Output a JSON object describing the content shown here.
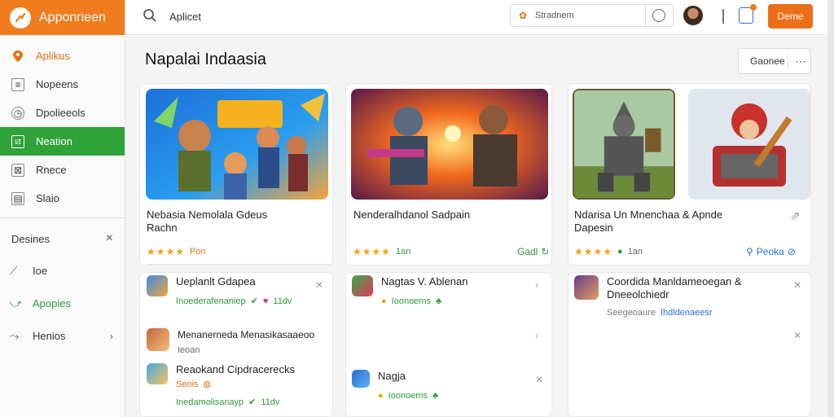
{
  "sidebar": {
    "brand": "Apponrieen",
    "items": [
      {
        "label": "Aplikus",
        "icon": "pin-icon"
      },
      {
        "label": "Nopeens",
        "icon": "list-icon"
      },
      {
        "label": "Dpolieeols",
        "icon": "clock-icon"
      },
      {
        "label": "Neation",
        "icon": "grid-icon"
      },
      {
        "label": "Rnece",
        "icon": "calendar-icon"
      },
      {
        "label": "Slaio",
        "icon": "doc-icon"
      }
    ],
    "section_label": "Desines",
    "section_close": "×",
    "links": [
      {
        "label": "Ioe",
        "icon": "wrench-icon"
      },
      {
        "label": "Apopies",
        "icon": "share-icon"
      },
      {
        "label": "Henios",
        "icon": "tag-icon"
      }
    ]
  },
  "topbar": {
    "search_label": "Aplicet",
    "search_box": "Stradnem",
    "button": "Deme"
  },
  "main": {
    "title": "Napalai Indaasia",
    "sort": "Gaonee",
    "featured": [
      {
        "title": "Nebasia Nemolala Gdeus Rachn",
        "stars": "★★★★",
        "rating": "Pon",
        "action": ""
      },
      {
        "title": "Nenderalhdanol Sadpain",
        "stars": "★★★★",
        "rating": "1an",
        "action": "Gadl"
      },
      {
        "title": "Ndarisa Un Mnenchaa & Apnde Dapesin",
        "stars": "★★★★",
        "rating": "1an",
        "action": "Peoka"
      }
    ],
    "list1": [
      {
        "title": "Ueplanlt Gdapea",
        "sub": "Inoederafenaniep"
      },
      {
        "title": "Menanerneda Menasikasaaeoo",
        "sub": "Ieoan"
      },
      {
        "title": "Reaokand Cipdracerecks",
        "sub": "Senis",
        "sub2": "Inedamolisanayp"
      }
    ],
    "list2": [
      {
        "title": "Nagtas V. Ablenan",
        "sub": "Ioonoems"
      },
      {
        "title": "Nagja",
        "sub": "Ioonoems"
      }
    ],
    "list3": [
      {
        "title": "Coordida Manldameoegan & Dneeolchiedr",
        "sub": "Seegeoaure",
        "link": "Ihdldenaeesr"
      }
    ],
    "v_badge": "11dv"
  }
}
